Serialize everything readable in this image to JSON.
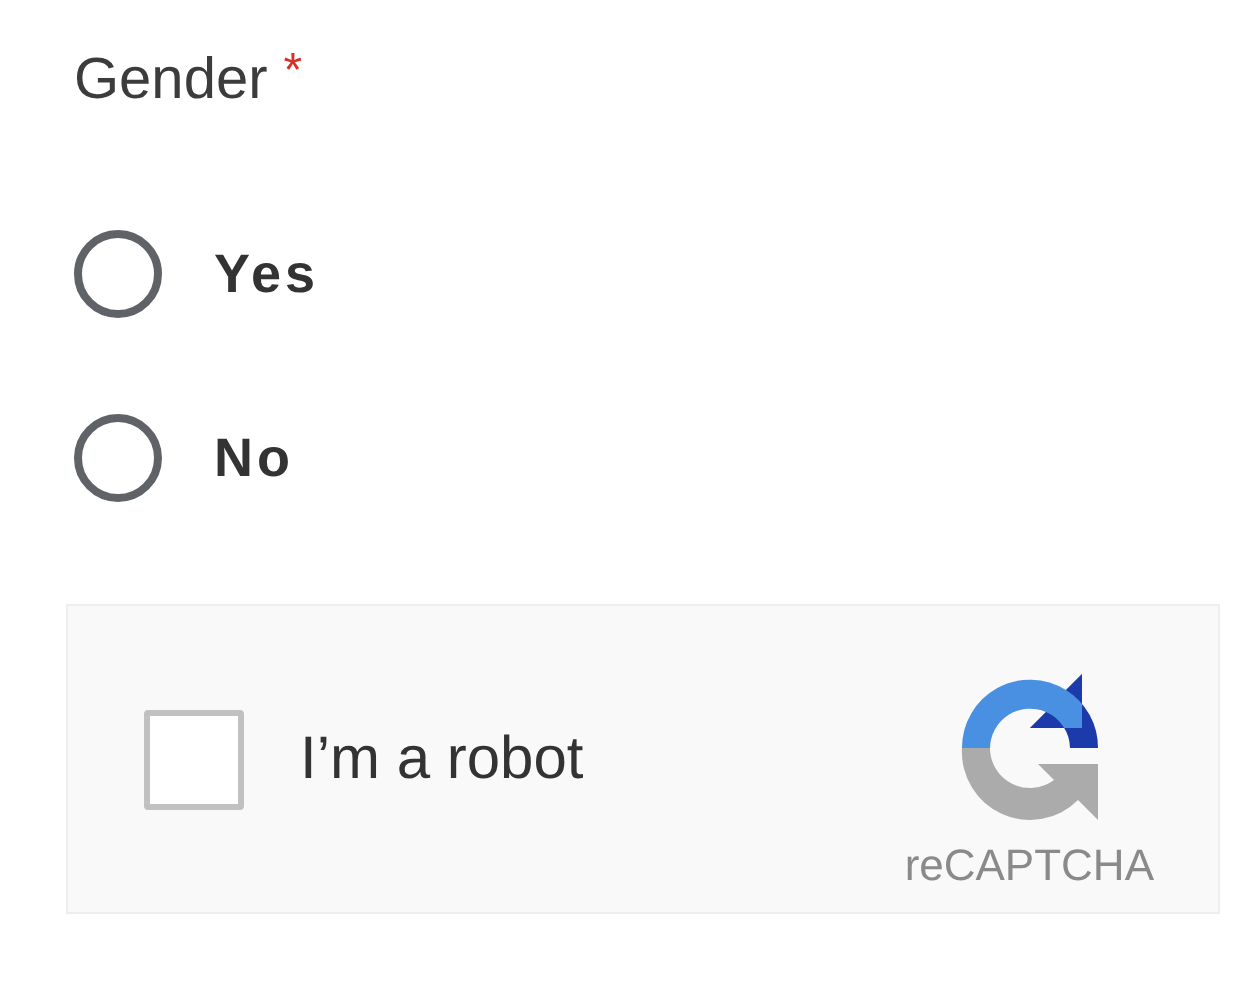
{
  "question": {
    "label": "Gender",
    "required_mark": "*"
  },
  "options": [
    {
      "label": "Yes",
      "selected": false
    },
    {
      "label": "No",
      "selected": false
    }
  ],
  "captcha": {
    "label": "I’m a robot",
    "checked": false,
    "brand": "reCAPTCHA"
  }
}
